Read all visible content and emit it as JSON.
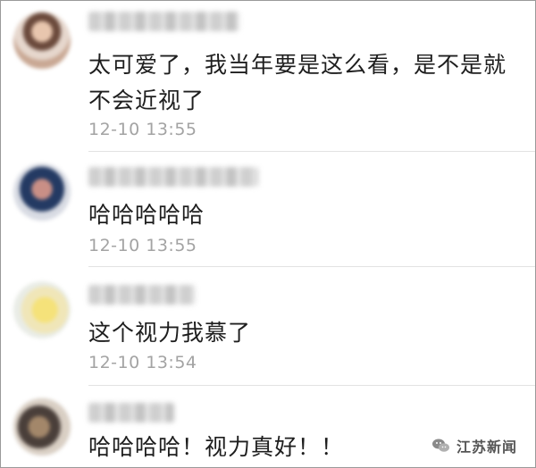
{
  "comments": [
    {
      "text": "太可爱了，我当年要是这么看，是不是就不会近视了",
      "time": "12-10 13:55",
      "avatar_icon": "avatar-icon"
    },
    {
      "text": "哈哈哈哈哈",
      "time": "12-10 13:55",
      "avatar_icon": "avatar-icon"
    },
    {
      "text": "这个视力我慕了",
      "time": "12-10 13:54",
      "avatar_icon": "avatar-icon"
    },
    {
      "text": "哈哈哈哈！视力真好！！",
      "time": "",
      "avatar_icon": "avatar-icon"
    }
  ],
  "watermark": {
    "text": "江苏新闻",
    "icon": "wechat-icon"
  },
  "colors": {
    "text": "#1e1e1e",
    "timestamp": "#a3a3a3",
    "divider": "#e2e2e2",
    "border": "#9a9a9a"
  }
}
